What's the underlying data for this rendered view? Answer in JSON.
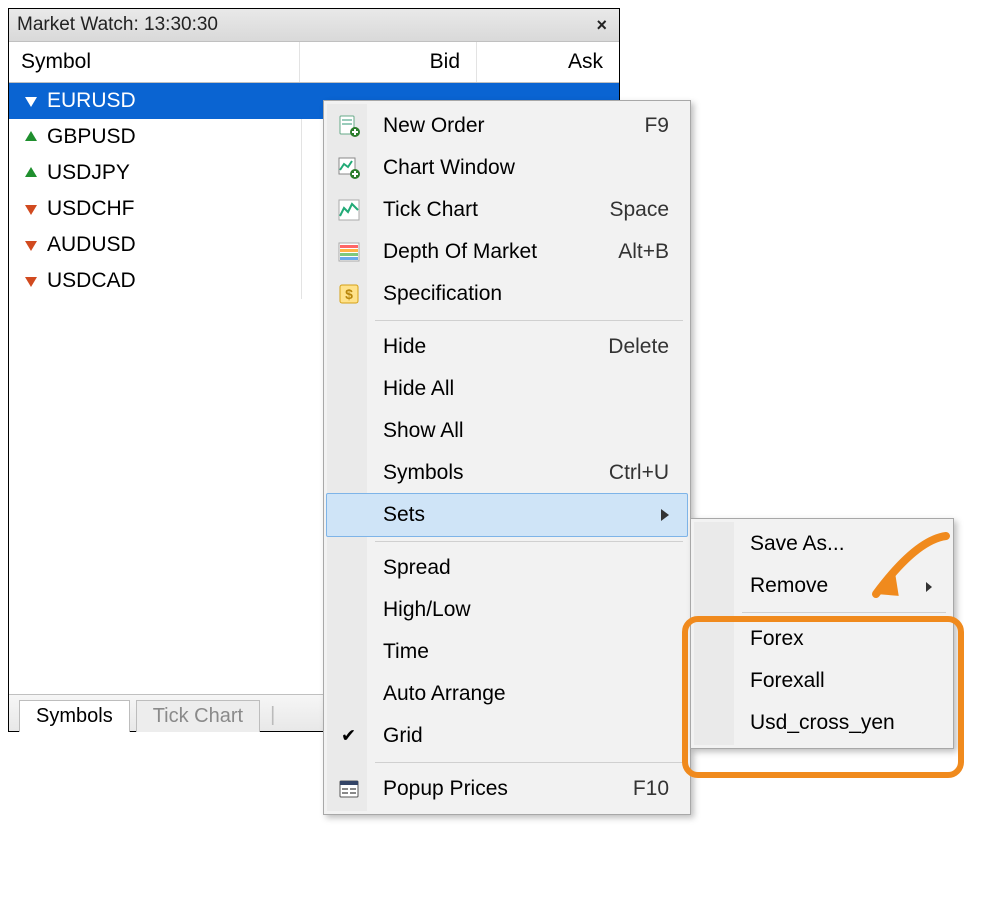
{
  "panel": {
    "title": "Market Watch: 13:30:30",
    "columns": {
      "symbol": "Symbol",
      "bid": "Bid",
      "ask": "Ask"
    },
    "rows": [
      {
        "sym": "EURUSD",
        "dir": "down",
        "bid": "",
        "ask": "",
        "selected": true
      },
      {
        "sym": "GBPUSD",
        "dir": "up",
        "bid": "",
        "ask": "",
        "selected": false
      },
      {
        "sym": "USDJPY",
        "dir": "up",
        "bid": "",
        "ask": "",
        "selected": false
      },
      {
        "sym": "USDCHF",
        "dir": "down",
        "bid": "",
        "ask": "",
        "selected": false
      },
      {
        "sym": "AUDUSD",
        "dir": "down",
        "bid": "",
        "ask": "",
        "selected": false
      },
      {
        "sym": "USDCAD",
        "dir": "down",
        "bid": "",
        "ask": "",
        "selected": false
      }
    ],
    "tabs": {
      "symbols": "Symbols",
      "tickchart": "Tick Chart"
    }
  },
  "menu": {
    "new_order": {
      "label": "New Order",
      "shortcut": "F9"
    },
    "chart_window": {
      "label": "Chart Window",
      "shortcut": ""
    },
    "tick_chart": {
      "label": "Tick Chart",
      "shortcut": "Space"
    },
    "depth": {
      "label": "Depth Of Market",
      "shortcut": "Alt+B"
    },
    "spec": {
      "label": "Specification",
      "shortcut": ""
    },
    "hide": {
      "label": "Hide",
      "shortcut": "Delete"
    },
    "hide_all": {
      "label": "Hide All",
      "shortcut": ""
    },
    "show_all": {
      "label": "Show All",
      "shortcut": ""
    },
    "symbols": {
      "label": "Symbols",
      "shortcut": "Ctrl+U"
    },
    "sets": {
      "label": "Sets",
      "shortcut": ""
    },
    "spread": {
      "label": "Spread",
      "shortcut": ""
    },
    "highlow": {
      "label": "High/Low",
      "shortcut": ""
    },
    "time": {
      "label": "Time",
      "shortcut": ""
    },
    "auto": {
      "label": "Auto Arrange",
      "shortcut": ""
    },
    "grid": {
      "label": "Grid",
      "shortcut": ""
    },
    "popup": {
      "label": "Popup Prices",
      "shortcut": "F10"
    }
  },
  "submenu": {
    "save": "Save As...",
    "remove": "Remove",
    "forex": "Forex",
    "forexall": "Forexall",
    "usdcross": "Usd_cross_yen"
  }
}
